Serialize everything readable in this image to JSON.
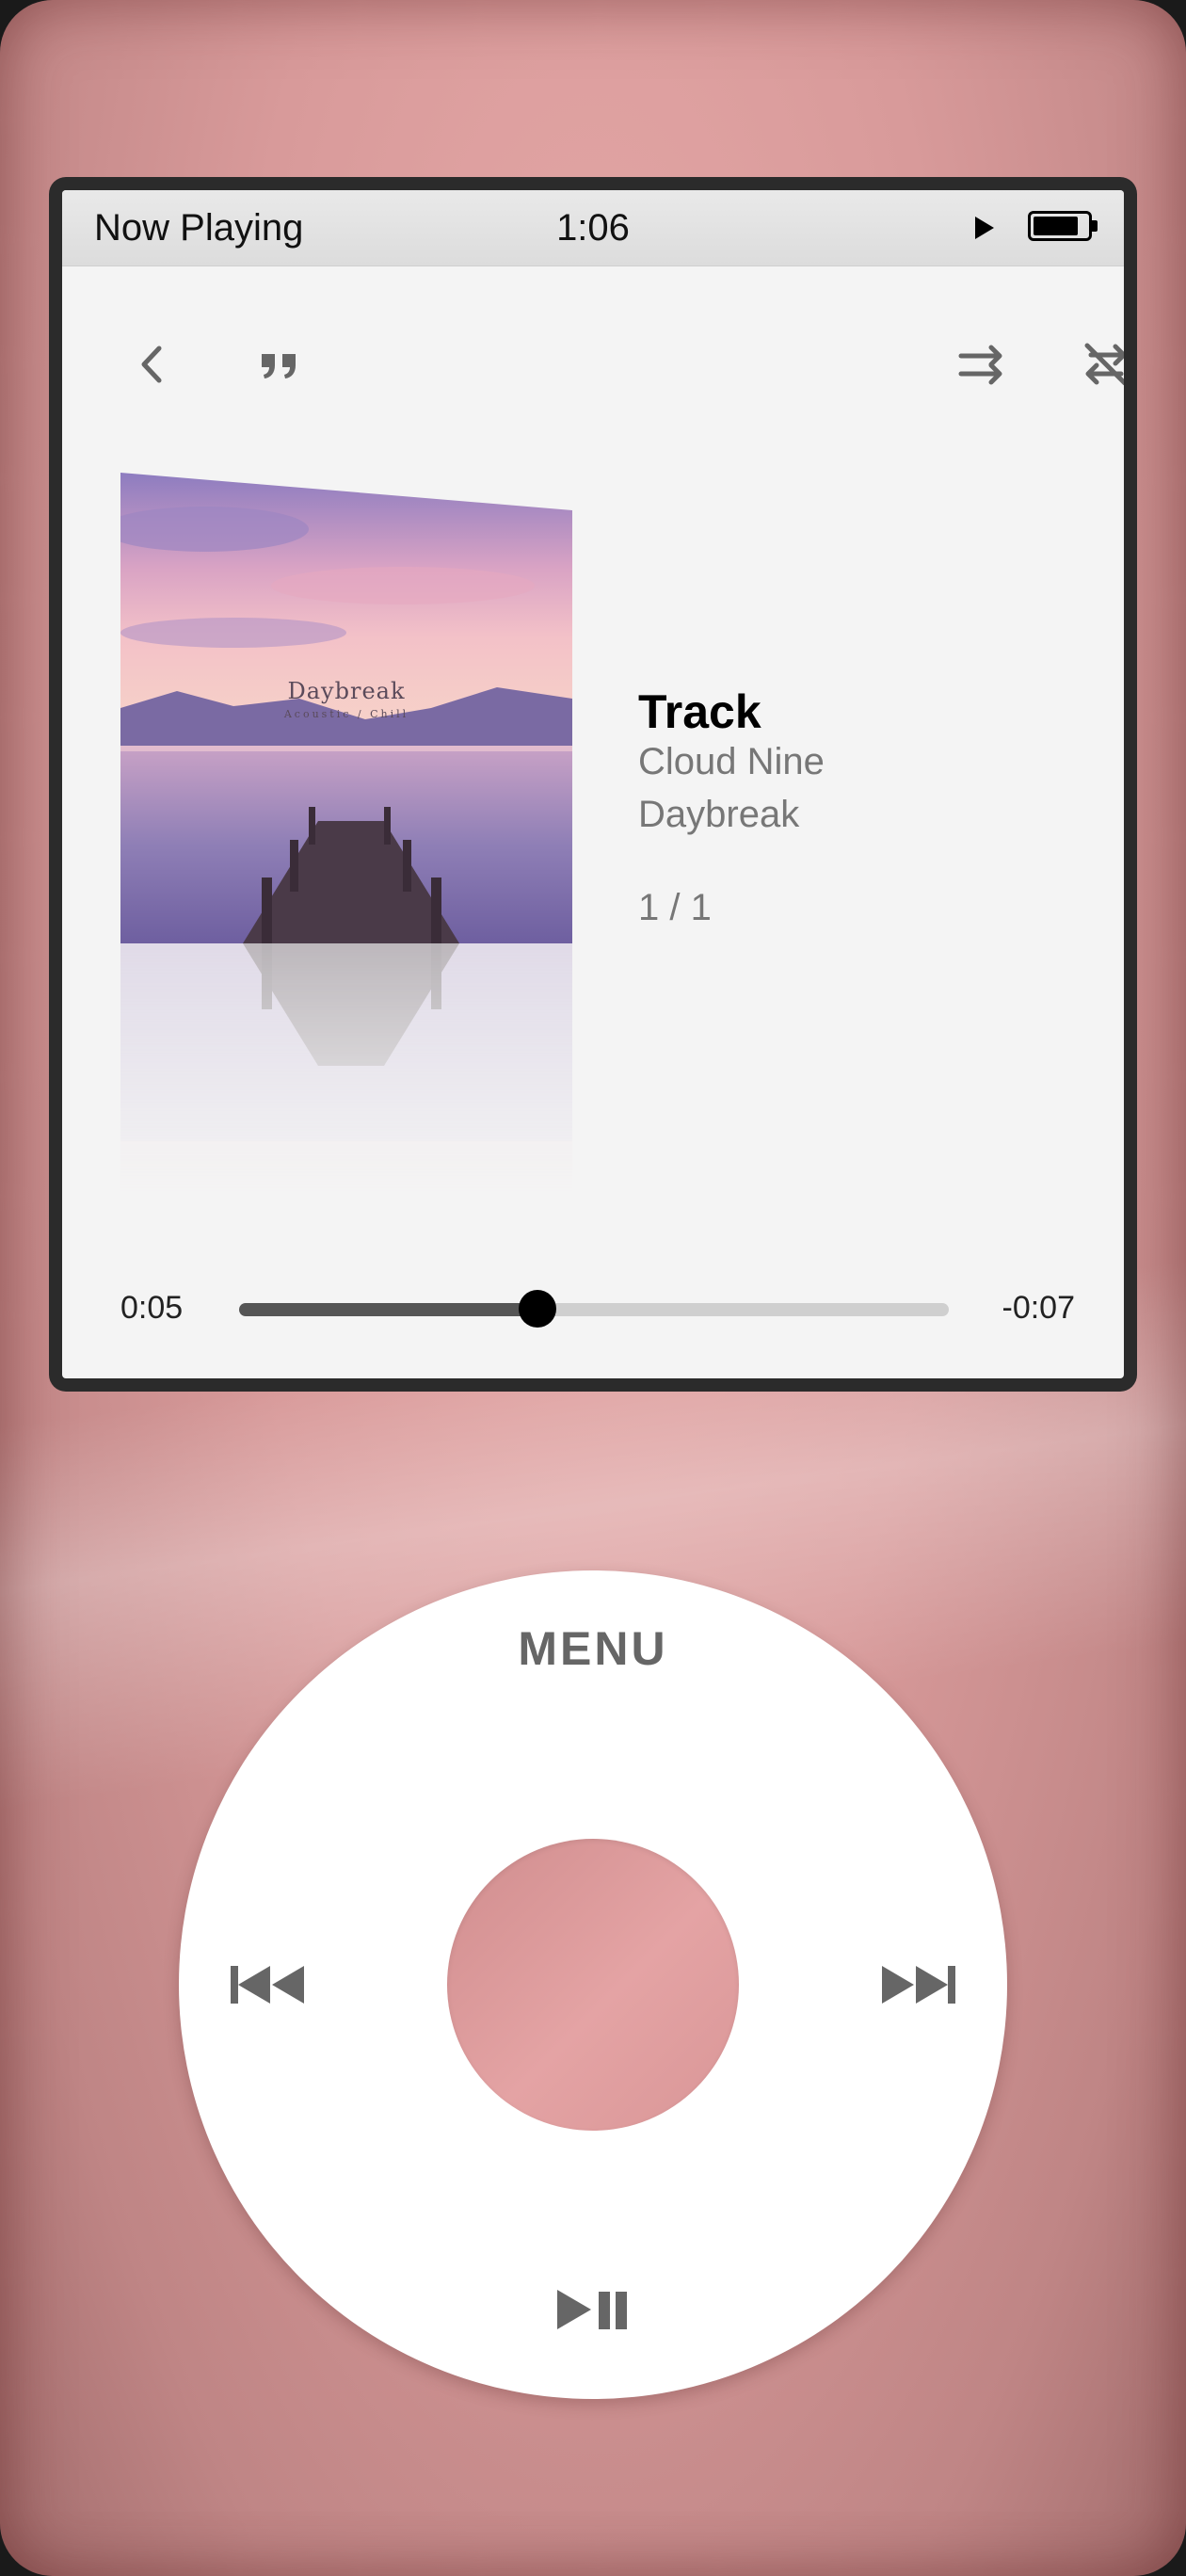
{
  "status_bar": {
    "title": "Now Playing",
    "time": "1:06",
    "battery_level": 0.85
  },
  "toolbar": {
    "back_icon": "chevron-left-icon",
    "lyrics_icon": "quote-icon",
    "repeat_icon": "repeat-icon",
    "shuffle_icon": "shuffle-off-icon"
  },
  "album_art": {
    "title": "Daybreak",
    "subtitle": "Acoustic / Chill"
  },
  "track": {
    "title": "Track",
    "artist": "Cloud Nine",
    "album": "Daybreak",
    "position": "1 / 1"
  },
  "progress": {
    "elapsed": "0:05",
    "remaining": "-0:07",
    "fraction": 0.42
  },
  "click_wheel": {
    "menu_label": "MENU",
    "prev_icon": "previous-track-icon",
    "next_icon": "next-track-icon",
    "play_pause_icon": "play-pause-icon"
  },
  "colors": {
    "body": "#d89a9a",
    "center_button": "#e4a3a4",
    "wheel": "#ffffff",
    "screen": "#f4f4f4"
  }
}
